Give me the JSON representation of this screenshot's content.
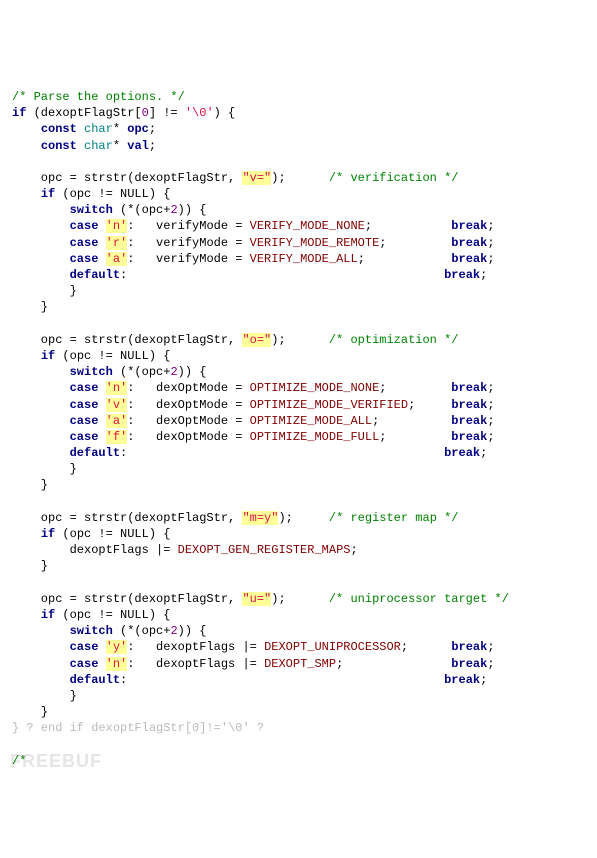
{
  "c": {
    "l1": "/* Parse the options. */",
    "l2a": "if",
    "l2b": " (dexoptFlagStr[",
    "l2c": "0",
    "l2d": "] != ",
    "l2e": "'\\0'",
    "l2f": ") {",
    "l3a": "    ",
    "l3b": "const",
    "l3c": " ",
    "l3d": "char",
    "l3e": "* ",
    "l3f": "opc",
    "l3g": ";",
    "l4a": "    ",
    "l4b": "const",
    "l4c": " ",
    "l4d": "char",
    "l4e": "* ",
    "l4f": "val",
    "l4g": ";",
    "blank1": "",
    "l5a": "    opc = strstr(dexoptFlagStr, ",
    "l5b": "\"v=\"",
    "l5c": ");      ",
    "l5d": "/* verification */",
    "l6a": "    ",
    "l6b": "if",
    "l6c": " (opc != NULL) {",
    "l7a": "        ",
    "l7b": "switch",
    "l7c": " (*(opc+",
    "l7d": "2",
    "l7e": ")) {",
    "l8a": "        ",
    "l8b": "case",
    "l8c": " ",
    "l8d": "'n'",
    "l8e": ":   verifyMode = ",
    "l8f": "VERIFY_MODE_NONE",
    "l8g": ";           ",
    "l8h": "break",
    "l8i": ";",
    "l9a": "        ",
    "l9b": "case",
    "l9c": " ",
    "l9d": "'r'",
    "l9e": ":   verifyMode = ",
    "l9f": "VERIFY_MODE_REMOTE",
    "l9g": ";         ",
    "l9h": "break",
    "l9i": ";",
    "l10a": "        ",
    "l10b": "case",
    "l10c": " ",
    "l10d": "'a'",
    "l10e": ":   verifyMode = ",
    "l10f": "VERIFY_MODE_ALL",
    "l10g": ";            ",
    "l10h": "break",
    "l10i": ";",
    "l11a": "        ",
    "l11b": "default",
    "l11c": ":                                            ",
    "l11d": "break",
    "l11e": ";",
    "l12": "        }",
    "l13": "    }",
    "blank2": "",
    "l14a": "    opc = strstr(dexoptFlagStr, ",
    "l14b": "\"o=\"",
    "l14c": ");      ",
    "l14d": "/* optimization */",
    "l15a": "    ",
    "l15b": "if",
    "l15c": " (opc != NULL) {",
    "l16a": "        ",
    "l16b": "switch",
    "l16c": " (*(opc+",
    "l16d": "2",
    "l16e": ")) {",
    "l17a": "        ",
    "l17b": "case",
    "l17c": " ",
    "l17d": "'n'",
    "l17e": ":   dexOptMode = ",
    "l17f": "OPTIMIZE_MODE_NONE",
    "l17g": ";         ",
    "l17h": "break",
    "l17i": ";",
    "l18a": "        ",
    "l18b": "case",
    "l18c": " ",
    "l18d": "'v'",
    "l18e": ":   dexOptMode = ",
    "l18f": "OPTIMIZE_MODE_VERIFIED",
    "l18g": ";     ",
    "l18h": "break",
    "l18i": ";",
    "l19a": "        ",
    "l19b": "case",
    "l19c": " ",
    "l19d": "'a'",
    "l19e": ":   dexOptMode = ",
    "l19f": "OPTIMIZE_MODE_ALL",
    "l19g": ";          ",
    "l19h": "break",
    "l19i": ";",
    "l20a": "        ",
    "l20b": "case",
    "l20c": " ",
    "l20d": "'f'",
    "l20e": ":   dexOptMode = ",
    "l20f": "OPTIMIZE_MODE_FULL",
    "l20g": ";         ",
    "l20h": "break",
    "l20i": ";",
    "l21a": "        ",
    "l21b": "default",
    "l21c": ":                                            ",
    "l21d": "break",
    "l21e": ";",
    "l22": "        }",
    "l23": "    }",
    "blank3": "",
    "l24a": "    opc = strstr(dexoptFlagStr, ",
    "l24b": "\"m=y\"",
    "l24c": ");     ",
    "l24d": "/* register map */",
    "l25a": "    ",
    "l25b": "if",
    "l25c": " (opc != NULL) {",
    "l26a": "        dexoptFlags |= ",
    "l26b": "DEXOPT_GEN_REGISTER_MAPS",
    "l26c": ";",
    "l27": "    }",
    "blank4": "",
    "l28a": "    opc = strstr(dexoptFlagStr, ",
    "l28b": "\"u=\"",
    "l28c": ");      ",
    "l28d": "/* uniprocessor target */",
    "l29a": "    ",
    "l29b": "if",
    "l29c": " (opc != NULL) {",
    "l30a": "        ",
    "l30b": "switch",
    "l30c": " (*(opc+",
    "l30d": "2",
    "l30e": ")) {",
    "l31a": "        ",
    "l31b": "case",
    "l31c": " ",
    "l31d": "'y'",
    "l31e": ":   dexoptFlags |= ",
    "l31f": "DEXOPT_UNIPROCESSOR",
    "l31g": ";      ",
    "l31h": "break",
    "l31i": ";",
    "l32a": "        ",
    "l32b": "case",
    "l32c": " ",
    "l32d": "'n'",
    "l32e": ":   dexoptFlags |= ",
    "l32f": "DEXOPT_SMP",
    "l32g": ";               ",
    "l32h": "break",
    "l32i": ";",
    "l33a": "        ",
    "l33b": "default",
    "l33c": ":                                            ",
    "l33d": "break",
    "l33e": ";",
    "l34": "        }",
    "l35": "    }",
    "l36": "} ? end if dexoptFlagStr[0]!='\\0' ?",
    "blank5": "",
    "l37": "/*",
    "wm": "FREEBUF"
  }
}
